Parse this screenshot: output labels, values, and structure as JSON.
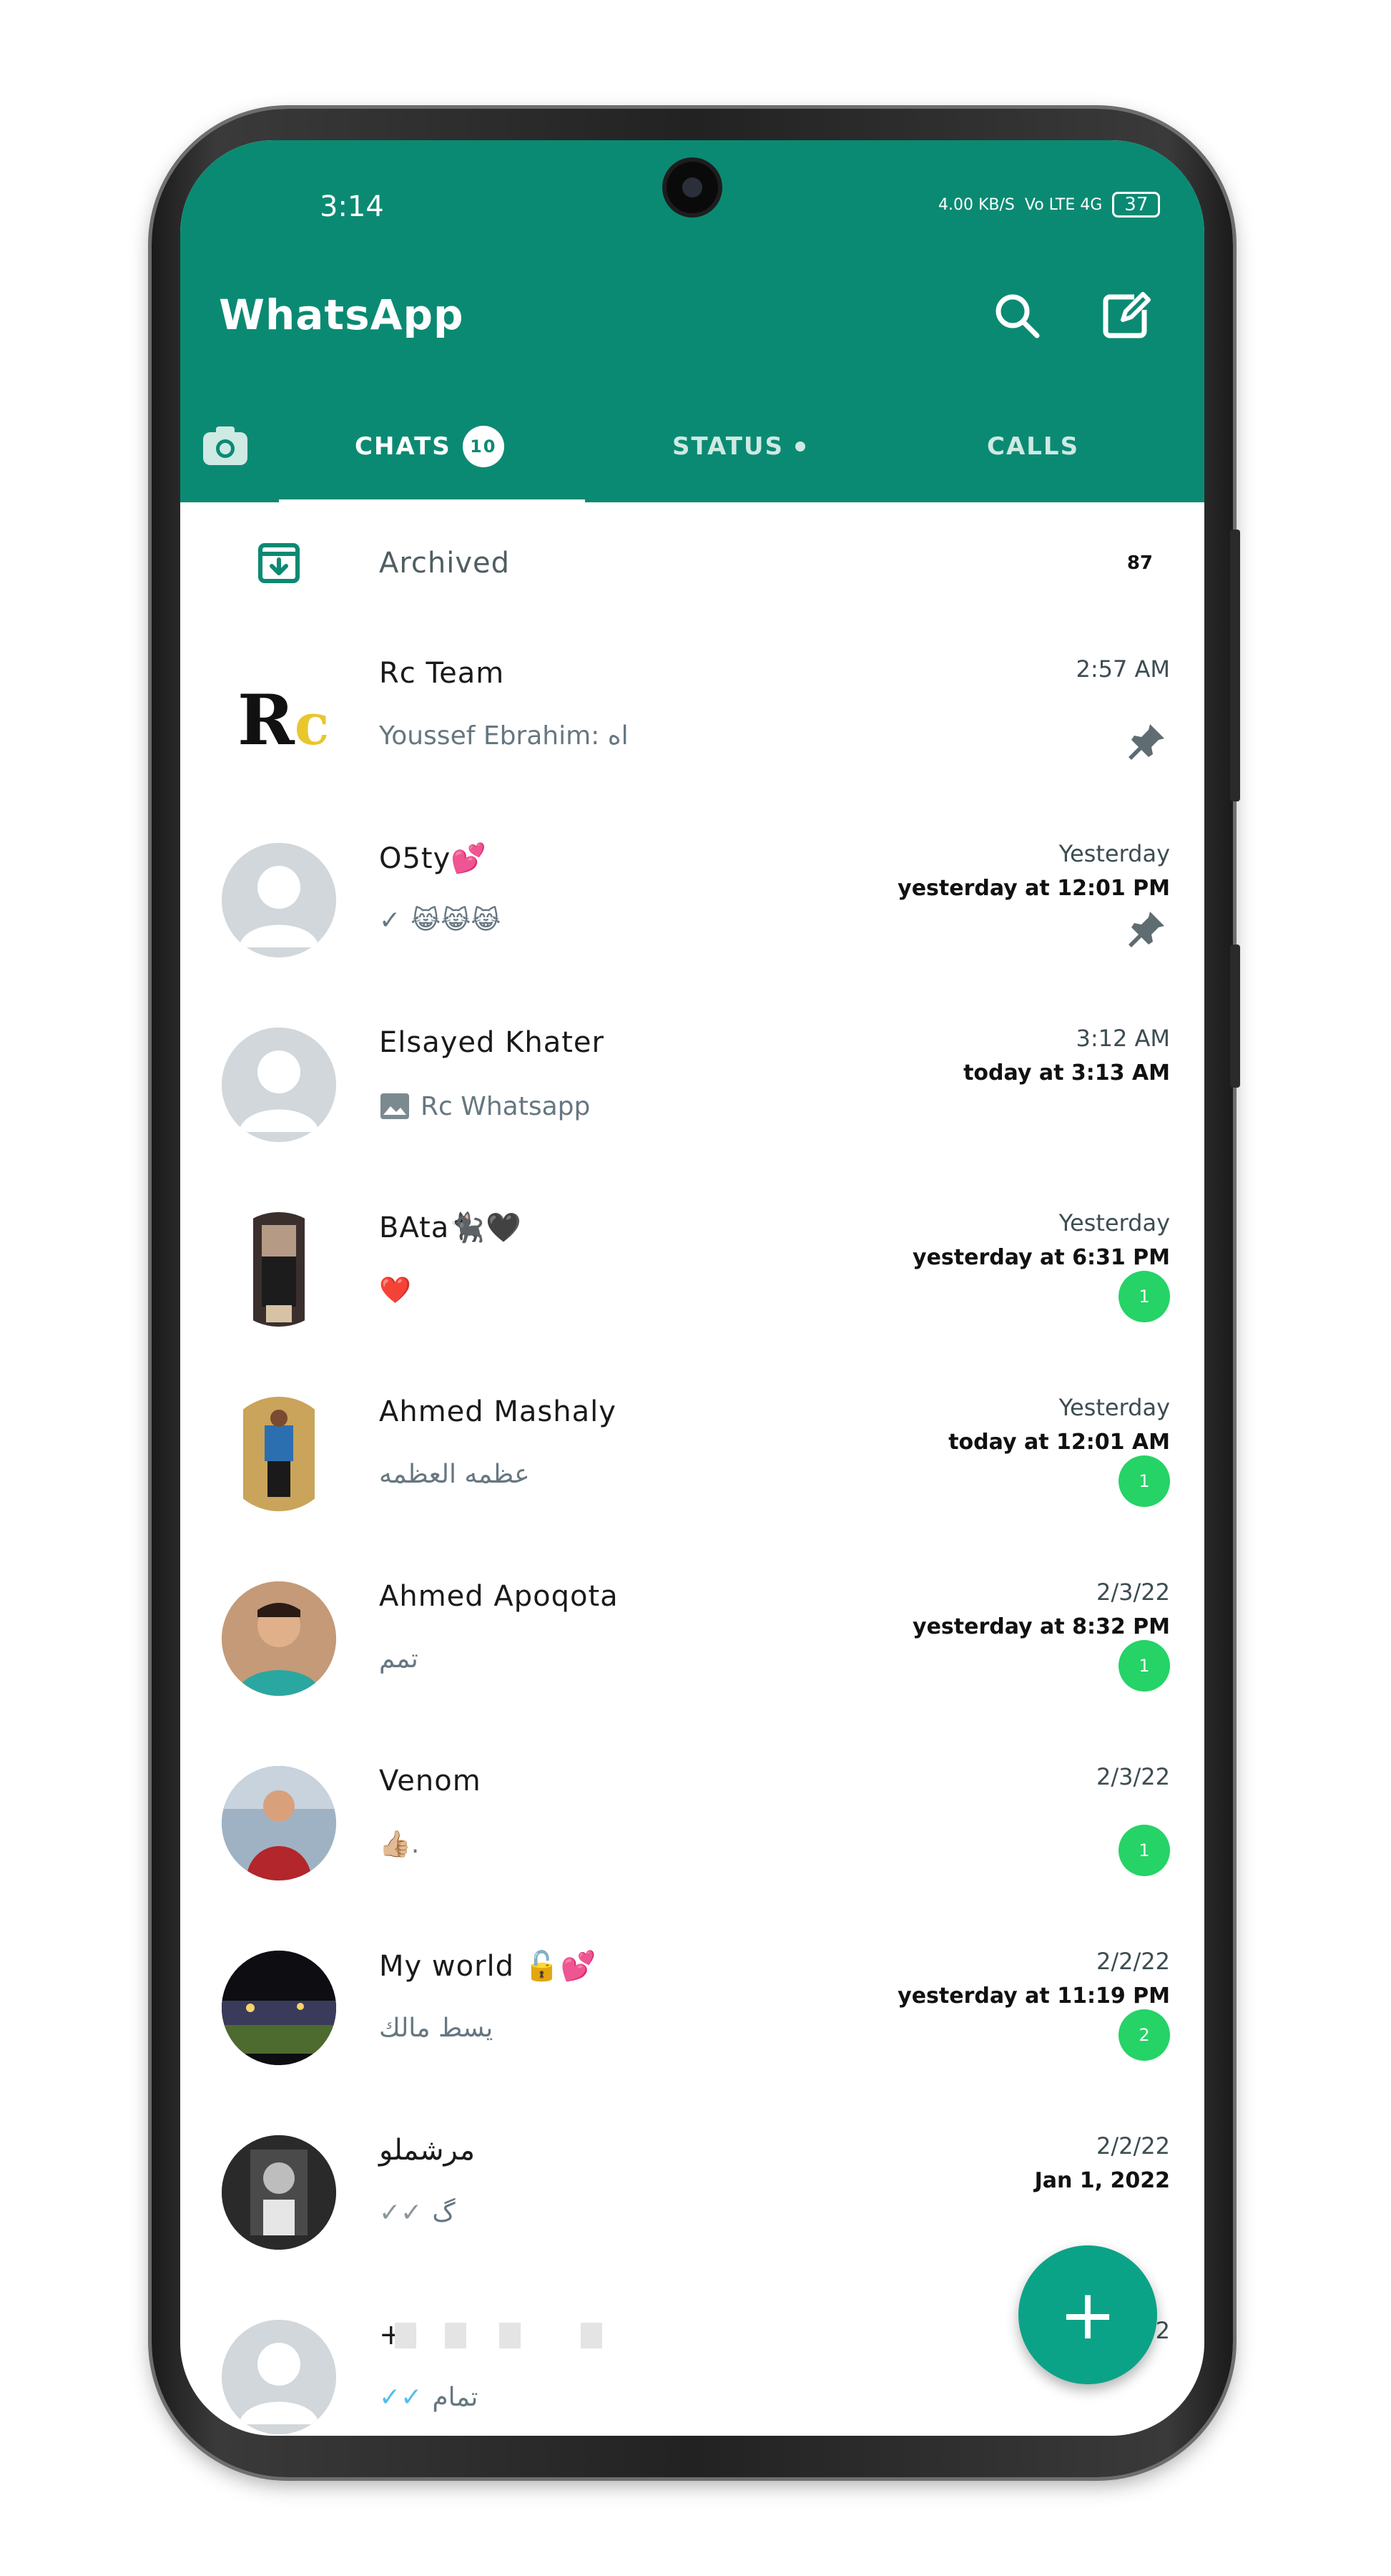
{
  "status_bar": {
    "time": "3:14",
    "speed": "4.00 KB/S",
    "net": "Vo LTE 4G",
    "battery": "37"
  },
  "header": {
    "title": "WhatsApp",
    "search_icon": "search-icon",
    "compose_icon": "compose-icon"
  },
  "tabs": [
    {
      "label": "CHATS",
      "badge": "10",
      "active": true
    },
    {
      "label": "STATUS",
      "dot": true
    },
    {
      "label": "CALLS"
    }
  ],
  "archived": {
    "label": "Archived",
    "count": "87"
  },
  "chats": [
    {
      "name": "Rc Team",
      "message": "Youssef Ebrahim: اه",
      "time": "2:57 AM",
      "sub": "",
      "pinned": true,
      "unread": ""
    },
    {
      "name": "O5ty💕",
      "message": "😹😹😹",
      "time": "Yesterday",
      "sub": "yesterday at 12:01 PM",
      "pinned": true,
      "unread": ""
    },
    {
      "name": "Elsayed Khater",
      "message": "Rc Whatsapp",
      "time": "3:12 AM",
      "sub": "today at 3:13 AM",
      "pinned": false,
      "unread": ""
    },
    {
      "name": "BAta🐈‍⬛🖤",
      "message": "❤️",
      "time": "Yesterday",
      "sub": "yesterday at 6:31 PM",
      "pinned": false,
      "unread": "1"
    },
    {
      "name": "Ahmed Mashaly",
      "message": "عظمه العظمه",
      "time": "Yesterday",
      "sub": "today at 12:01 AM",
      "pinned": false,
      "unread": "1"
    },
    {
      "name": "Ahmed Apoqota",
      "message": "تمم",
      "time": "2/3/22",
      "sub": "yesterday at 8:32 PM",
      "pinned": false,
      "unread": "1"
    },
    {
      "name": "Venom",
      "message": "👍🏼.",
      "time": "2/3/22",
      "sub": "",
      "pinned": false,
      "unread": "1"
    },
    {
      "name": "My world 🔓💕",
      "message": "يسط مالك",
      "time": "2/2/22",
      "sub": "yesterday at 11:19 PM",
      "pinned": false,
      "unread": "2"
    },
    {
      "name": "مرشملو",
      "message": "گ",
      "time": "2/2/22",
      "sub": "Jan 1, 2022",
      "pinned": false,
      "unread": ""
    },
    {
      "name": "+",
      "message": "تمام",
      "time": "22",
      "sub": "",
      "pinned": false,
      "unread": ""
    }
  ],
  "fab": {
    "label": "+"
  },
  "colors": {
    "header": "#0b8a73",
    "unread": "#25d366",
    "fab": "#0ba387"
  }
}
